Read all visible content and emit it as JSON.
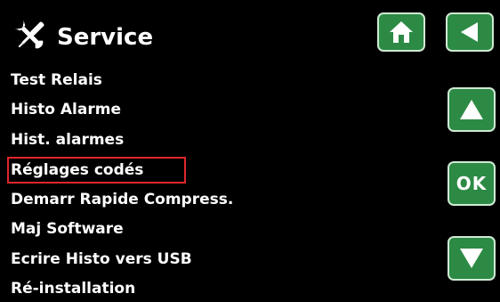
{
  "header": {
    "title": "Service",
    "icon": "tools-icon"
  },
  "menu": {
    "items": [
      {
        "label": "Test Relais"
      },
      {
        "label": "Histo Alarme"
      },
      {
        "label": "Hist. alarmes"
      },
      {
        "label": "Réglages codés",
        "selected": true
      },
      {
        "label": "Demarr Rapide Compress."
      },
      {
        "label": "Maj Software"
      },
      {
        "label": "Ecrire Histo vers USB"
      },
      {
        "label": "Ré-installation"
      }
    ]
  },
  "nav": {
    "ok_label": "OK",
    "home_icon": "home-icon",
    "back_icon": "back-arrow-icon",
    "up_icon": "up-arrow-icon",
    "down_icon": "down-arrow-icon"
  },
  "colors": {
    "button": "#2c8a45",
    "selection": "#e0262b",
    "background": "#000000"
  }
}
